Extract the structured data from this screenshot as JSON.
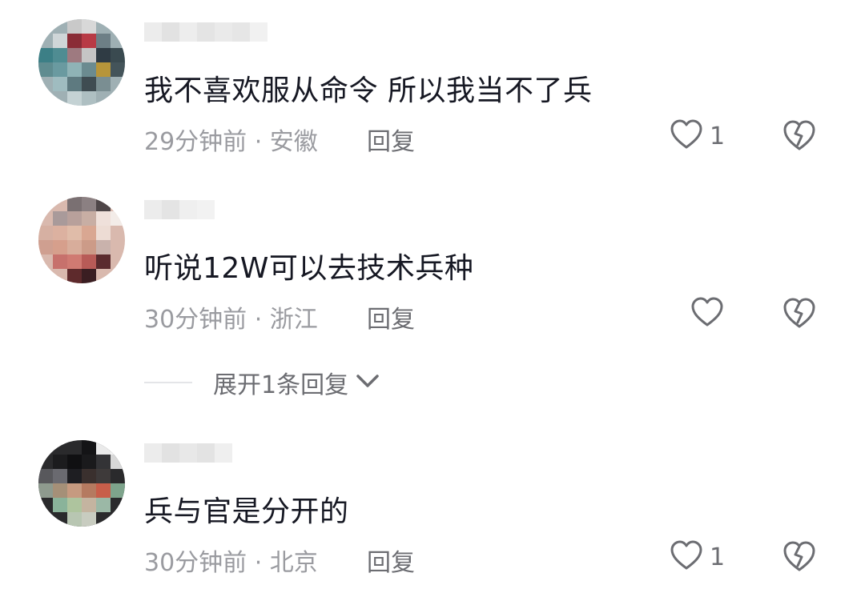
{
  "comments": [
    {
      "content": "我不喜欢服从命令 所以我当不了兵",
      "meta": "29分钟前 · 安徽",
      "reply": "回复",
      "likes": "1"
    },
    {
      "content": "听说12W可以去技术兵种",
      "meta": "30分钟前 · 浙江",
      "reply": "回复",
      "likes": ""
    },
    {
      "content": "兵与官是分开的",
      "meta": "30分钟前 · 北京",
      "reply": "回复",
      "likes": "1"
    }
  ],
  "expand_replies": "展开1条回复",
  "icons": {
    "like": "heart-outline-icon",
    "dislike": "broken-heart-icon",
    "expand": "chevron-down-icon"
  },
  "colors": {
    "text": "#161823",
    "meta": "#9a9ba0",
    "action": "#6c6d72"
  }
}
